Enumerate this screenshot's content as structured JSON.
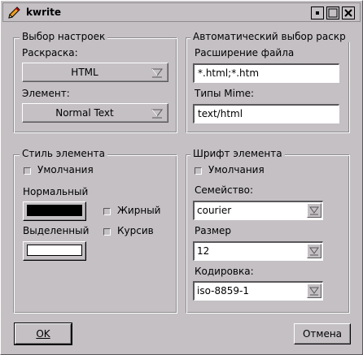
{
  "window": {
    "title": "kwrite"
  },
  "icons": {
    "app": "pencil-icon",
    "menu": "window-menu-icon",
    "minimize": "minimize-icon",
    "maximize": "maximize-icon",
    "close": "close-icon",
    "combo_arrow": "chevron-down-icon"
  },
  "highlight_group": {
    "title": "Выбор настроек",
    "highlight_label": "Раскраска:",
    "highlight_value": "HTML",
    "element_label": "Элемент:",
    "element_value": "Normal Text"
  },
  "auto_group": {
    "title": "Автоматический выбор раскр",
    "ext_label": "Расширение файла",
    "ext_value": "*.html;*.htm",
    "mime_label": "Типы Mime:",
    "mime_value": "text/html"
  },
  "style_group": {
    "title": "Стиль элемента",
    "default_label": "Умолчания",
    "normal_label": "Нормальный",
    "selected_label": "Выделенный",
    "bold_label": "Жирный",
    "italic_label": "Курсив",
    "normal_color": "#000000",
    "selected_color": "#ffffff"
  },
  "font_group": {
    "title": "Шрифт элемента",
    "default_label": "Умолчания",
    "family_label": "Семейство:",
    "family_value": "courier",
    "size_label": "Размер",
    "size_value": "12",
    "charset_label": "Кодировка:",
    "charset_value": "iso-8859-1"
  },
  "buttons": {
    "ok": "OK",
    "cancel": "Отмена"
  },
  "colors": {
    "background": "#c4c0c4",
    "shadow": "#5a585a",
    "light": "#ffffff"
  }
}
